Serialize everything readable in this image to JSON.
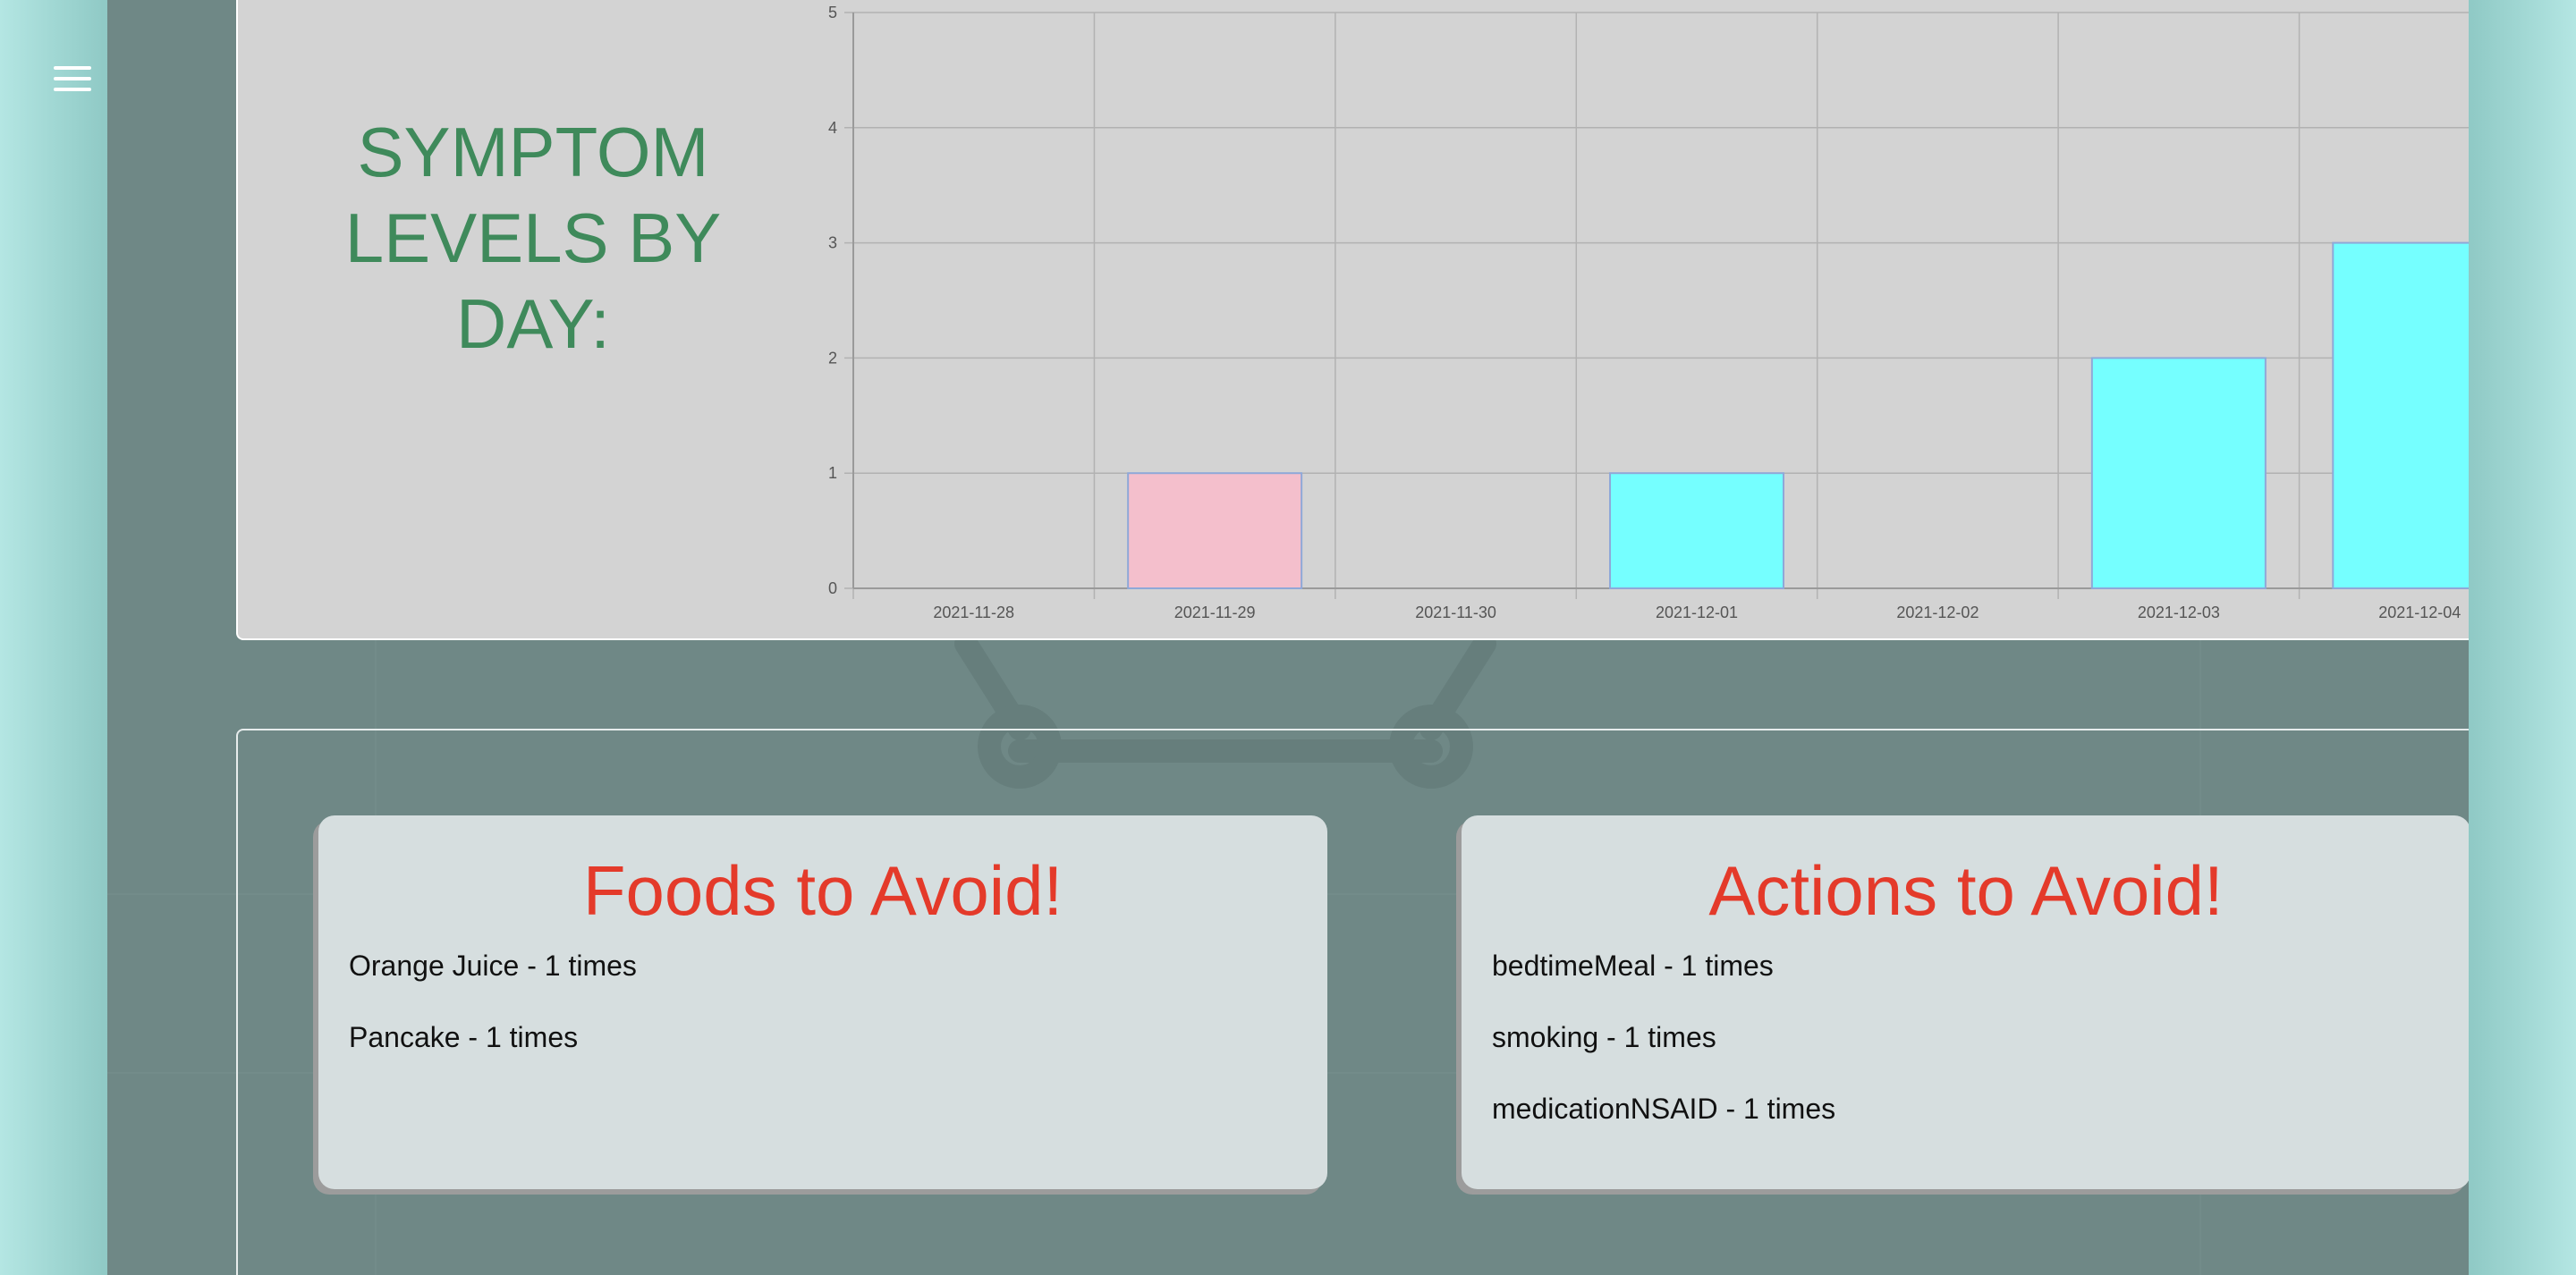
{
  "chart_data": {
    "type": "bar",
    "title": "SYMPTOM LEVELS BY DAY:",
    "categories": [
      "2021-11-28",
      "2021-11-29",
      "2021-11-30",
      "2021-12-01",
      "2021-12-02",
      "2021-12-03",
      "2021-12-04"
    ],
    "values": [
      0,
      1,
      0,
      1,
      0,
      2,
      3
    ],
    "bar_colors": [
      "#75ffff",
      "#f4bfcc",
      "#75ffff",
      "#75ffff",
      "#75ffff",
      "#75ffff",
      "#75ffff"
    ],
    "yticks": [
      "0",
      "1",
      "2",
      "3",
      "4",
      "5"
    ],
    "ylim": [
      0,
      5
    ],
    "grid": true,
    "xlabel": "",
    "ylabel": ""
  },
  "colors": {
    "title_green": "#3f8a5b",
    "card_heading_red": "#e43a2a"
  },
  "menu": {
    "icon": "hamburger-menu-icon"
  },
  "foods": {
    "title": "Foods to Avoid!",
    "items": [
      "Orange Juice - 1 times",
      "Pancake - 1 times"
    ]
  },
  "actions": {
    "title": "Actions to Avoid!",
    "items": [
      "bedtimeMeal - 1 times",
      "smoking - 1 times",
      "medicationNSAID - 1 times"
    ]
  }
}
